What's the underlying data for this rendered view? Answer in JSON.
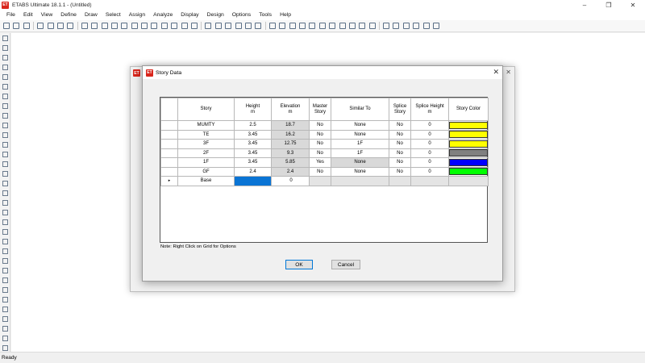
{
  "app": {
    "logo": "ET",
    "title": "ETABS Ultimate 18.1.1 - (Untitled)",
    "window_controls": [
      "–",
      "❐",
      "✕"
    ]
  },
  "menu": [
    "File",
    "Edit",
    "View",
    "Define",
    "Draw",
    "Select",
    "Assign",
    "Analyze",
    "Display",
    "Design",
    "Options",
    "Tools",
    "Help"
  ],
  "toolbar_icons": [
    "new-model-icon",
    "open-icon",
    "save-icon",
    "undo-icon",
    "redo-icon",
    "pencil-icon",
    "lock-icon",
    "run-icon",
    "zoom-in-icon",
    "zoom-window-icon",
    "zoom-out-icon",
    "zoom-prev-icon",
    "zoom-extents-icon",
    "pan-icon",
    "view-3d-icon",
    "view-plan-icon",
    "view-elev-icon",
    "rotate-icon",
    "refresh-icon",
    "move-up-icon",
    "move-down-icon",
    "object-shrink-icon",
    "display-options-icon",
    "set-display-icon",
    "assign-icon",
    "draw-frame-icon",
    "draw-beam-icon",
    "draw-column-icon",
    "draw-brace-icon",
    "draw-wall-icon",
    "draw-slab-icon",
    "draw-opening-icon",
    "draw-link-icon",
    "draw-grid-icon",
    "draw-dimension-icon",
    "draw-section-cut-icon",
    "select-icon",
    "assign-frame-icon",
    "assign-shell-icon",
    "load-icon",
    "diaphragm-icon",
    "pier-icon"
  ],
  "left_tools": [
    "pointer-icon",
    "reshape-icon",
    "draw-line-icon",
    "draw-beam-icon",
    "draw-brace-icon",
    "draw-column-icon",
    "draw-cross-icon",
    "draw-area-icon",
    "draw-floor-icon",
    "draw-rect-area-icon",
    "draw-wall-icon",
    "draw-opening-icon",
    "draw-wall-stack-icon",
    "draw-link-icon",
    "draw-point-icon",
    "draw-tendon-icon",
    "draw-rebar-icon",
    "draw-grid-icon",
    "draw-dimension-icon",
    "draw-section-icon",
    "draw-develop-icon",
    "draw-mesh-icon",
    "draw-spring-icon",
    "draw-support-icon",
    "draw-restraint-icon",
    "draw-reference-icon",
    "draw-snap-icon",
    "draw-snap-end-icon",
    "draw-snap-mid-icon",
    "draw-snap-grid-icon",
    "draw-snap-perp-icon",
    "draw-snap-line-icon",
    "draw-snap-ext-icon"
  ],
  "status": "Ready",
  "dialog": {
    "logo": "ET",
    "title": "Story Data",
    "close": "✕",
    "headers": {
      "story": "Story",
      "height": "Height\nm",
      "elevation": "Elevation\nm",
      "master": "Master\nStory",
      "similar": "Similar To",
      "splice": "Splice\nStory",
      "splice_height": "Splice Height\nm",
      "color": "Story Color"
    },
    "rows": [
      {
        "story": "MUMTY",
        "height": "2.5",
        "elevation": "18.7",
        "master": "No",
        "similar": "None",
        "splice": "No",
        "splice_height": "0",
        "color": "#ffff00"
      },
      {
        "story": "TE",
        "height": "3.45",
        "elevation": "16.2",
        "master": "No",
        "similar": "None",
        "splice": "No",
        "splice_height": "0",
        "color": "#ffff00"
      },
      {
        "story": "3F",
        "height": "3.45",
        "elevation": "12.75",
        "master": "No",
        "similar": "1F",
        "splice": "No",
        "splice_height": "0",
        "color": "#ffff00"
      },
      {
        "story": "2F",
        "height": "3.45",
        "elevation": "9.3",
        "master": "No",
        "similar": "1F",
        "splice": "No",
        "splice_height": "0",
        "color": "#808080"
      },
      {
        "story": "1F",
        "height": "3.45",
        "elevation": "5.85",
        "master": "Yes",
        "similar": "None",
        "splice": "No",
        "splice_height": "0",
        "color": "#0000ff"
      },
      {
        "story": "GF",
        "height": "2.4",
        "elevation": "2.4",
        "master": "No",
        "similar": "None",
        "splice": "No",
        "splice_height": "0",
        "color": "#00ff00"
      }
    ],
    "base": {
      "story": "Base",
      "marker": "▸",
      "elevation": "0"
    },
    "note": "Note:  Right Click on Grid for Options",
    "ok_label": "OK",
    "cancel_label": "Cancel"
  }
}
